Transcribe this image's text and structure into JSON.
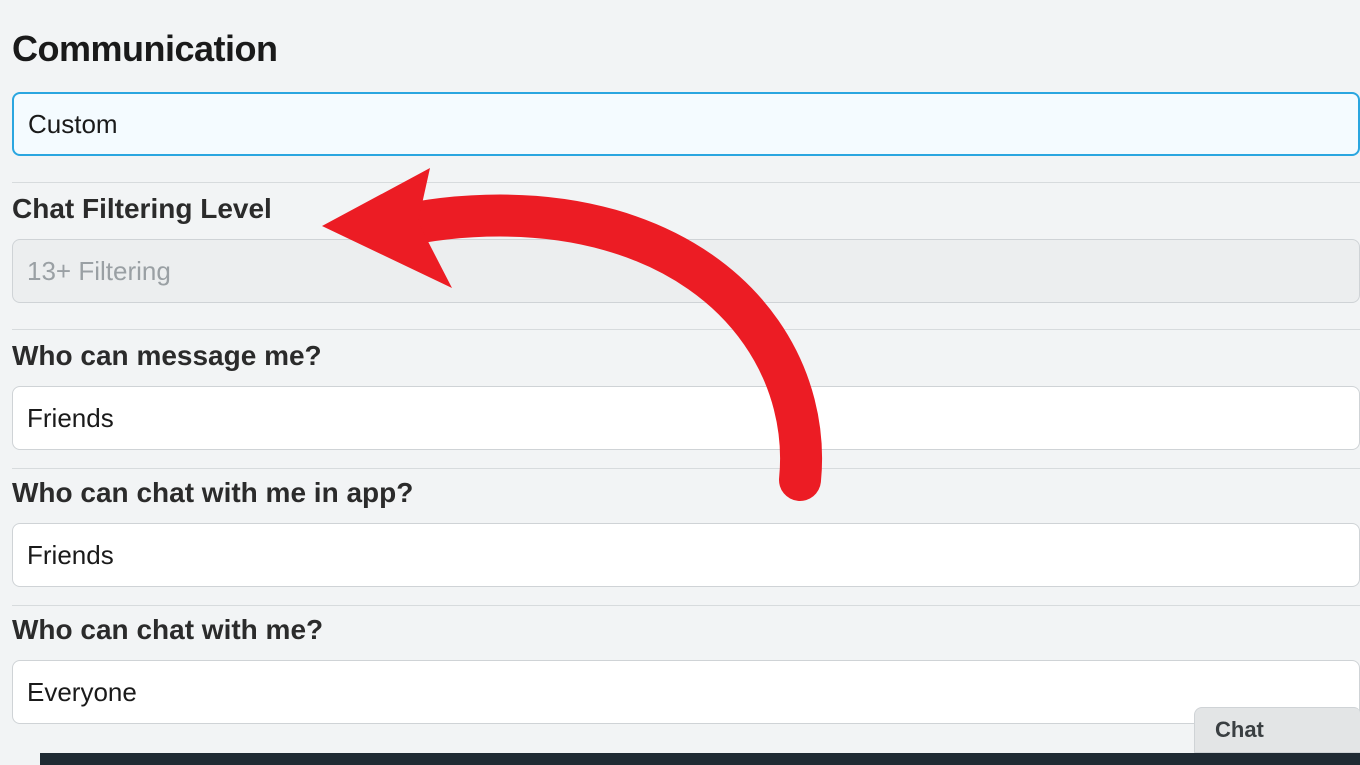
{
  "section": {
    "title": "Communication"
  },
  "communication": {
    "preset": "Custom",
    "filter": {
      "label": "Chat Filtering Level",
      "value": "13+ Filtering"
    },
    "message": {
      "label": "Who can message me?",
      "value": "Friends"
    },
    "chat_in_app": {
      "label": "Who can chat with me in app?",
      "value": "Friends"
    },
    "chat": {
      "label": "Who can chat with me?",
      "value": "Everyone"
    }
  },
  "chat_tab": {
    "label": "Chat"
  },
  "annotation": {
    "arrow_color": "#ec1c24"
  }
}
